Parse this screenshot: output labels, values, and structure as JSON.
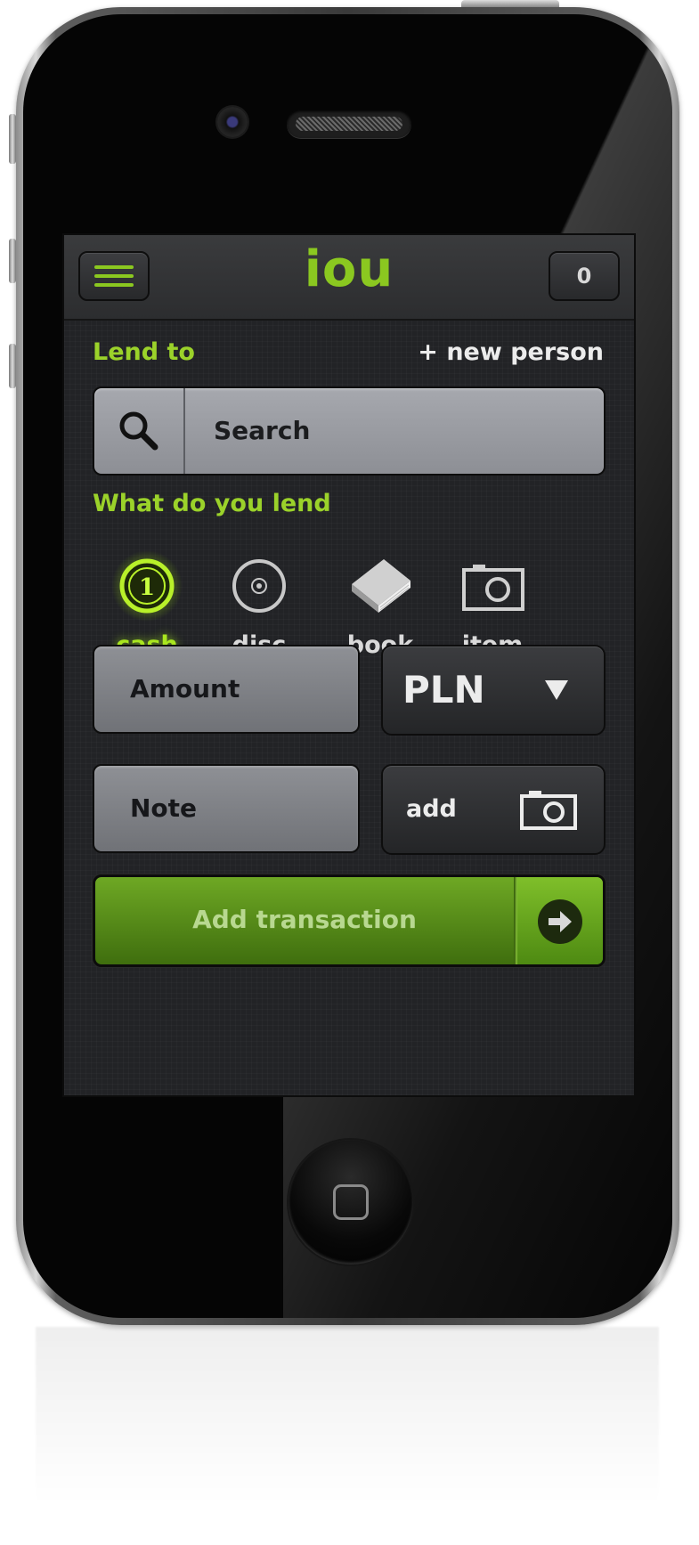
{
  "navbar": {
    "menu_icon": "hamburger-menu-icon",
    "title": "iou",
    "badge_count": "0"
  },
  "lend_to": {
    "label": "Lend to",
    "new_person": "+ new person",
    "search": {
      "placeholder": "Search",
      "icon": "search-icon"
    }
  },
  "what_lend": {
    "label": "What do you lend",
    "options": [
      {
        "label": "cash",
        "icon": "coin-icon",
        "selected": true
      },
      {
        "label": "disc",
        "icon": "disc-icon",
        "selected": false
      },
      {
        "label": "book",
        "icon": "book-icon",
        "selected": false
      },
      {
        "label": "item",
        "icon": "camera-icon",
        "selected": false
      }
    ],
    "coin_digit": "1"
  },
  "form": {
    "amount_placeholder": "Amount",
    "currency": "PLN",
    "note_placeholder": "Note",
    "add_photo_label": "add"
  },
  "submit": {
    "label": "Add transaction",
    "icon": "arrow-right-icon"
  },
  "colors": {
    "accent": "#8bc820",
    "screen_bg": "#222326",
    "cta_green": "#5a8f1b"
  }
}
